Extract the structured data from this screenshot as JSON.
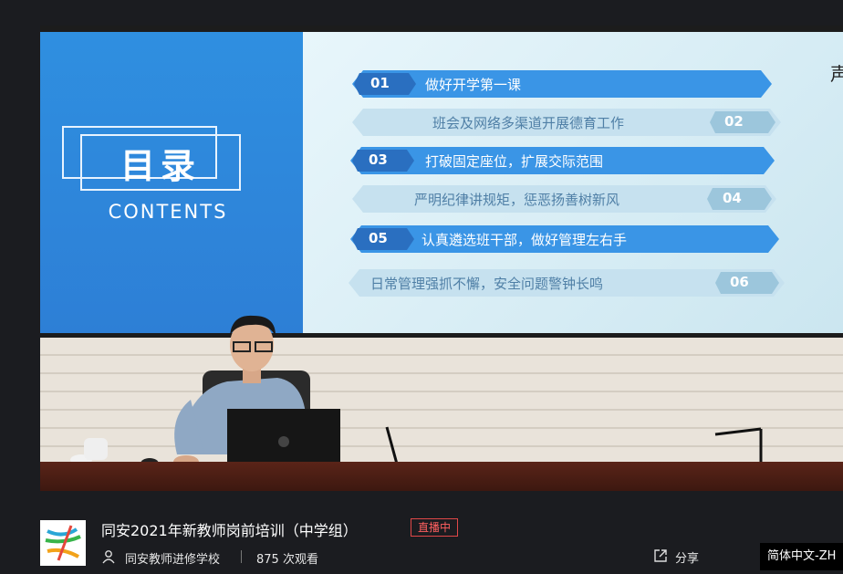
{
  "video": {
    "slide": {
      "title": "目录",
      "subtitle": "CONTENTS",
      "edge_char": "声",
      "items": [
        {
          "num": "01",
          "text": "做好开学第一课"
        },
        {
          "num": "02",
          "text": "班会及网络多渠道开展德育工作"
        },
        {
          "num": "03",
          "text": "打破固定座位，扩展交际范围"
        },
        {
          "num": "04",
          "text": "严明纪律讲规矩，惩恶扬善树新风"
        },
        {
          "num": "05",
          "text": "认真遴选班干部，做好管理左右手"
        },
        {
          "num": "06",
          "text": "日常管理强抓不懈，安全问题警钟长鸣"
        }
      ]
    }
  },
  "info": {
    "title": "同安2021年新教师岗前培训（中学组）",
    "live_badge": "直播中",
    "organization": "同安教师进修学校",
    "views": "875 次观看",
    "share_label": "分享",
    "language": "简体中文-ZH"
  },
  "colors": {
    "slide_blue": "#2f8fe0",
    "live_red": "#ff6060",
    "background": "#1b1c20"
  }
}
